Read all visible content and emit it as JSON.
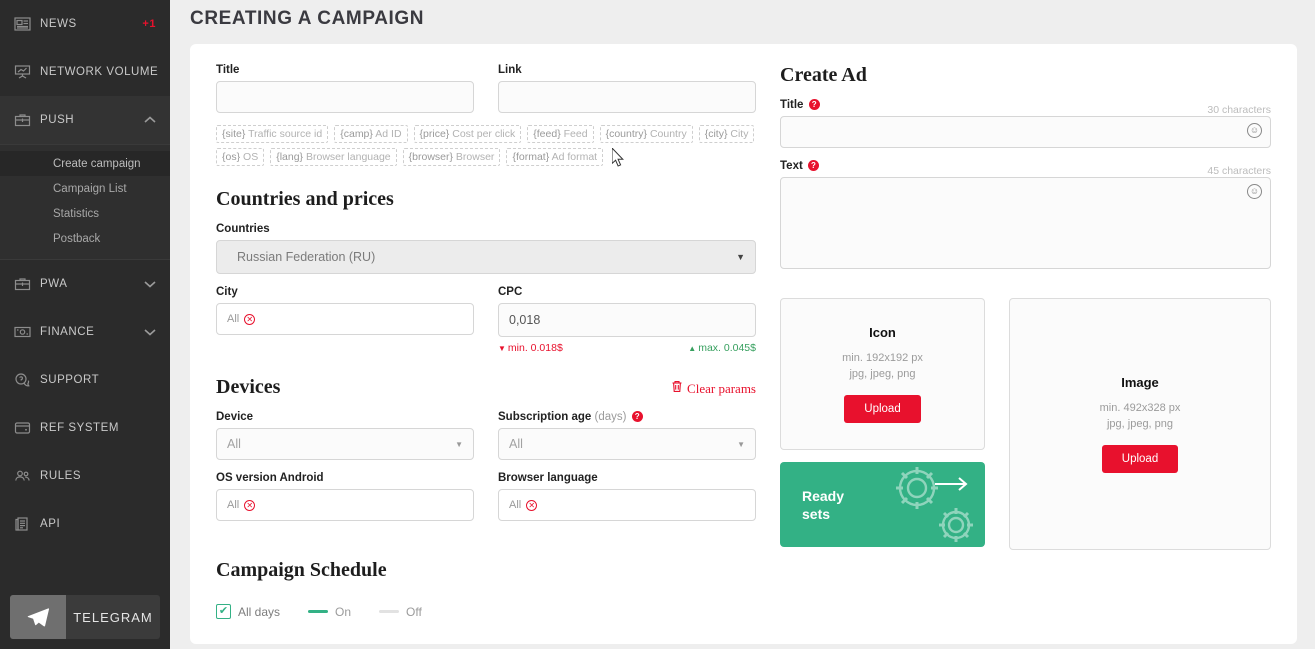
{
  "sidebar": {
    "items": [
      {
        "label": "NEWS",
        "icon": "news-icon",
        "badge": "+1",
        "chevron": ""
      },
      {
        "label": "NETWORK VOLUME",
        "icon": "chart-board-icon",
        "badge": "",
        "chevron": ""
      },
      {
        "label": "PUSH",
        "icon": "briefcase-icon",
        "badge": "",
        "chevron": "▲"
      },
      {
        "label": "PWA",
        "icon": "briefcase-icon",
        "badge": "",
        "chevron": "▼"
      },
      {
        "label": "FINANCE",
        "icon": "money-card-icon",
        "badge": "",
        "chevron": "▼"
      },
      {
        "label": "SUPPORT",
        "icon": "chat-question-icon",
        "badge": "",
        "chevron": ""
      },
      {
        "label": "REF SYSTEM",
        "icon": "wallet-icon",
        "badge": "",
        "chevron": ""
      },
      {
        "label": "RULES",
        "icon": "people-icon",
        "badge": "",
        "chevron": ""
      },
      {
        "label": "API",
        "icon": "documents-icon",
        "badge": "",
        "chevron": ""
      }
    ],
    "submenu": [
      {
        "label": "Create campaign",
        "selected": true
      },
      {
        "label": "Campaign List",
        "selected": false
      },
      {
        "label": "Statistics",
        "selected": false
      },
      {
        "label": "Postback",
        "selected": false
      }
    ],
    "telegram": {
      "label": "TELEGRAM",
      "icon": "telegram-paper-plane-icon"
    }
  },
  "page": {
    "title": "CREATING A CAMPAIGN"
  },
  "form": {
    "title_label": "Title",
    "title_value": "",
    "link_label": "Link",
    "link_value": "",
    "macros": [
      {
        "token": "{site}",
        "desc": "Traffic source id"
      },
      {
        "token": "{camp}",
        "desc": "Ad ID"
      },
      {
        "token": "{price}",
        "desc": "Cost per click"
      },
      {
        "token": "{feed}",
        "desc": "Feed"
      },
      {
        "token": "{country}",
        "desc": "Country"
      },
      {
        "token": "{city}",
        "desc": "City"
      },
      {
        "token": "{os}",
        "desc": "OS"
      },
      {
        "token": "{lang}",
        "desc": "Browser language"
      },
      {
        "token": "{browser}",
        "desc": "Browser"
      },
      {
        "token": "{format}",
        "desc": "Ad format"
      }
    ]
  },
  "countries": {
    "section_title": "Countries and prices",
    "countries_label": "Countries",
    "countries_value": "Russian Federation (RU)",
    "city_label": "City",
    "city_tag": "All",
    "cpc_label": "CPC",
    "cpc_value": "0,018",
    "min_text": "min. 0.018$",
    "max_text": "max. 0.045$"
  },
  "devices": {
    "section_title": "Devices",
    "clear_params": "Clear params",
    "device_label": "Device",
    "device_value": "All",
    "subage_label": "Subscription age",
    "subage_suffix": "(days)",
    "subage_value": "All",
    "osver_label": "OS version Android",
    "osver_tag": "All",
    "browserlang_label": "Browser language",
    "browserlang_tag": "All"
  },
  "create_ad": {
    "section_title": "Create Ad",
    "title_label": "Title",
    "title_counter": "30 characters",
    "title_value": "",
    "text_label": "Text",
    "text_counter": "45 characters",
    "text_value": "",
    "icon_card": {
      "title": "Icon",
      "size": "min. 192x192 px",
      "formats": "jpg, jpeg, png",
      "button": "Upload"
    },
    "image_card": {
      "title": "Image",
      "size": "min. 492x328 px",
      "formats": "jpg, jpeg, png",
      "button": "Upload"
    },
    "ready_sets": {
      "line1": "Ready",
      "line2": "sets"
    }
  },
  "schedule": {
    "section_title": "Campaign Schedule",
    "all_days": "All days",
    "on": "On",
    "off": "Off"
  },
  "colors": {
    "accent_red": "#e8112d",
    "green": "#33b185",
    "sidebar_bg": "#2b2b2b"
  }
}
